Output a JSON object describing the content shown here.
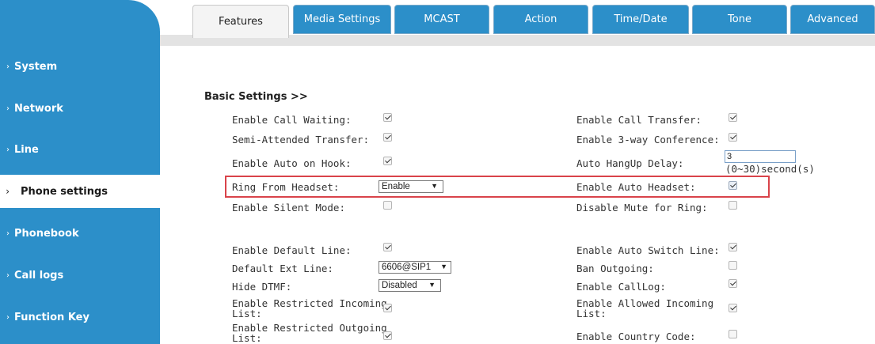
{
  "sidebar": {
    "items": [
      {
        "label": "System"
      },
      {
        "label": "Network"
      },
      {
        "label": "Line"
      },
      {
        "label": "Phone settings",
        "active": true
      },
      {
        "label": "Phonebook"
      },
      {
        "label": "Call logs"
      },
      {
        "label": "Function Key"
      }
    ],
    "chevron": "›"
  },
  "tabs": [
    {
      "label": "Features",
      "active": true
    },
    {
      "label": "Media Settings"
    },
    {
      "label": "MCAST"
    },
    {
      "label": "Action"
    },
    {
      "label": "Time/Date"
    },
    {
      "label": "Tone"
    },
    {
      "label": "Advanced"
    }
  ],
  "section": {
    "title": "Basic Settings >>"
  },
  "fields": {
    "call_waiting": {
      "label": "Enable Call Waiting:",
      "checked": true
    },
    "call_transfer": {
      "label": "Enable Call Transfer:",
      "checked": true
    },
    "semi_attended": {
      "label": "Semi-Attended Transfer:",
      "checked": true
    },
    "three_way": {
      "label": "Enable 3-way Conference:",
      "checked": true
    },
    "auto_on_hook": {
      "label": "Enable Auto on Hook:",
      "checked": true
    },
    "auto_hangup": {
      "label": "Auto HangUp Delay:",
      "value": "3",
      "hint": "(0~30)second(s)"
    },
    "ring_from_headset": {
      "label": "Ring From Headset:",
      "value": "Enable"
    },
    "auto_headset": {
      "label": "Enable Auto Headset:",
      "checked": true
    },
    "silent_mode": {
      "label": "Enable Silent Mode:",
      "checked": false
    },
    "disable_mute": {
      "label": "Disable Mute for Ring:",
      "checked": false
    },
    "default_line": {
      "label": "Enable Default Line:",
      "checked": true
    },
    "auto_switch": {
      "label": "Enable Auto Switch Line:",
      "checked": true
    },
    "default_ext": {
      "label": "Default Ext Line:",
      "value": "6606@SIP1"
    },
    "ban_outgoing": {
      "label": "Ban Outgoing:",
      "checked": false
    },
    "hide_dtmf": {
      "label": "Hide DTMF:",
      "value": "Disabled"
    },
    "call_log": {
      "label": "Enable CallLog:",
      "checked": true
    },
    "restricted_incoming": {
      "label_line1": "Enable Restricted Incoming",
      "label_line2": "List:",
      "checked": true
    },
    "allowed_incoming": {
      "label_line1": "Enable Allowed Incoming",
      "label_line2": "List:",
      "checked": true
    },
    "restricted_outgoing": {
      "label_line1": "Enable Restricted Outgoing",
      "label_line2": "List:",
      "checked": true
    },
    "country_code": {
      "label": "Enable Country Code:",
      "checked": false
    }
  },
  "dropdown_arrow": "▼",
  "colors": {
    "sidebar": "#2c8fc9",
    "highlight": "#d9434a",
    "tab_inactive": "#2c8fc9"
  }
}
